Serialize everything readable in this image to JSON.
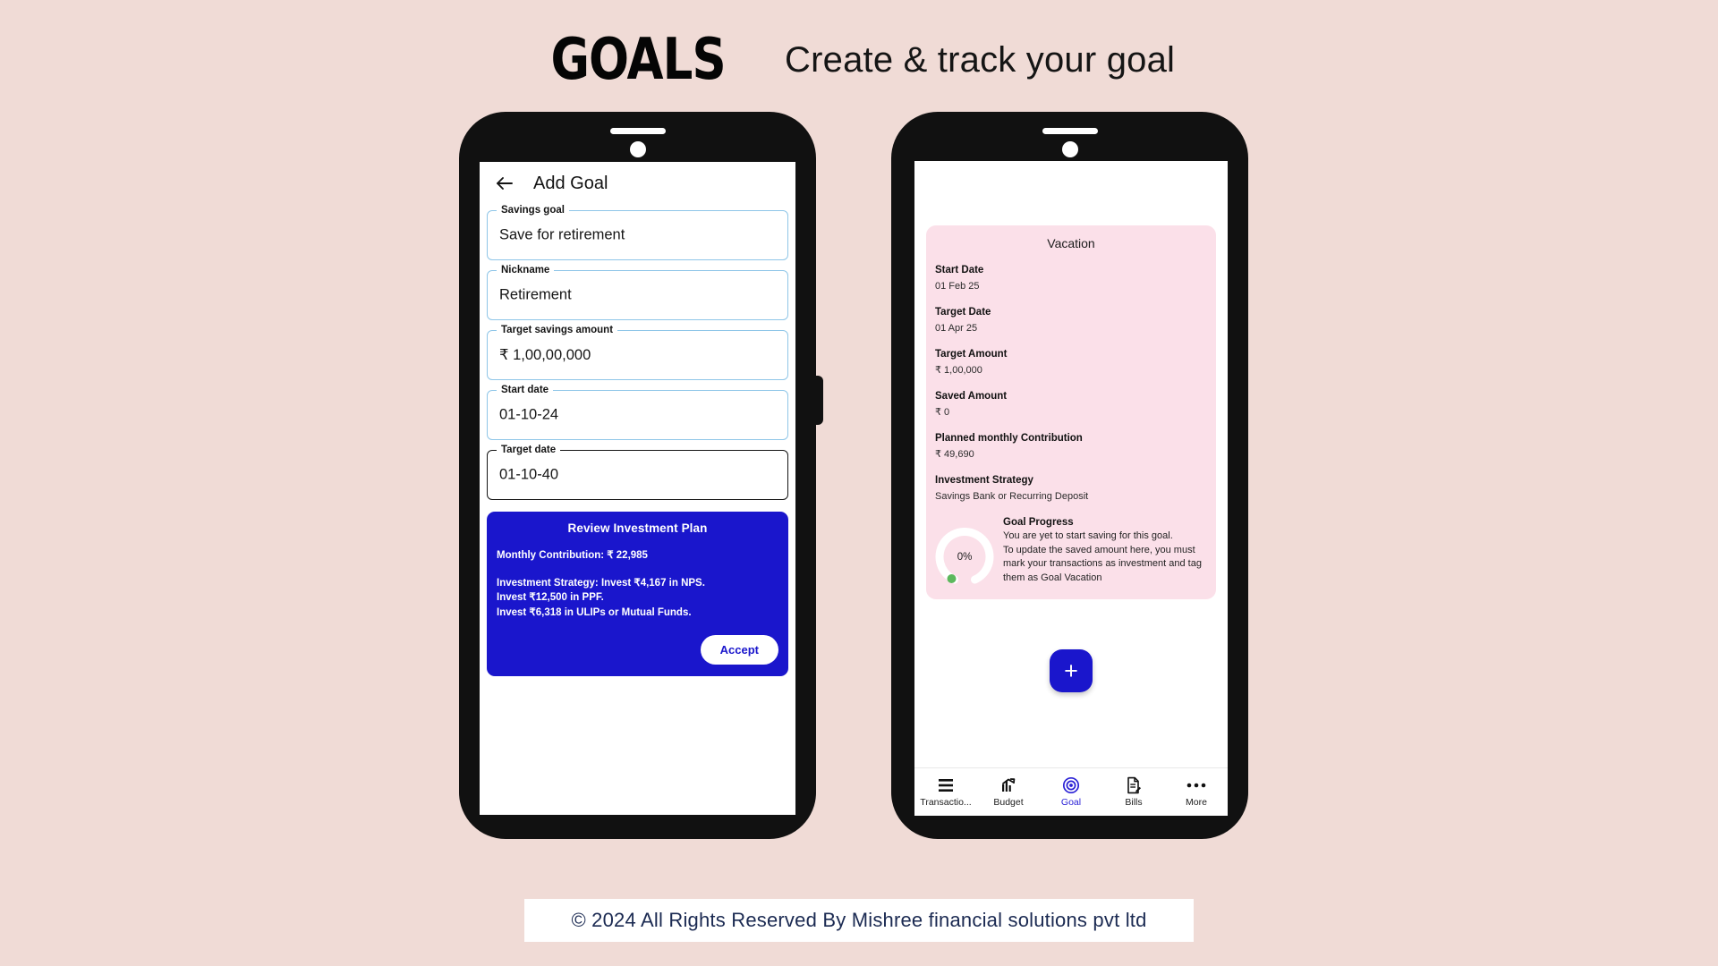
{
  "header": {
    "brand": "GOALS",
    "tagline": "Create & track your goal"
  },
  "left_phone": {
    "appbar": {
      "back_icon": "arrow-left-icon",
      "title": "Add Goal"
    },
    "fields": [
      {
        "label": "Savings goal",
        "value": "Save for retirement",
        "focused": false
      },
      {
        "label": "Nickname",
        "value": "Retirement",
        "focused": false
      },
      {
        "label": "Target savings amount",
        "value": "₹ 1,00,00,000",
        "focused": false
      },
      {
        "label": "Start date",
        "value": "01-10-24",
        "focused": false
      },
      {
        "label": "Target date",
        "value": "01-10-40",
        "focused": true
      }
    ],
    "review_panel": {
      "title": "Review Investment Plan",
      "monthly_contribution": "Monthly Contribution: ₹ 22,985",
      "strategy_lines": [
        "Investment Strategy: Invest ₹4,167 in NPS.",
        "Invest ₹12,500 in PPF.",
        "Invest ₹6,318 in ULIPs or Mutual Funds."
      ],
      "accept_label": "Accept",
      "background_color": "#1A16CC"
    }
  },
  "right_phone": {
    "goal_card": {
      "title": "Vacation",
      "background_color": "#FBE0E9",
      "details": [
        {
          "key": "Start Date",
          "value": "01 Feb 25"
        },
        {
          "key": "Target Date",
          "value": "01 Apr 25"
        },
        {
          "key": "Target Amount",
          "value": "₹ 1,00,000"
        },
        {
          "key": "Saved Amount",
          "value": "₹ 0"
        },
        {
          "key": "Planned monthly Contribution",
          "value": "₹ 49,690"
        },
        {
          "key": "Investment Strategy",
          "value": "Savings Bank  or Recurring Deposit"
        }
      ],
      "progress": {
        "percent_label": "0%",
        "percent_value": 0,
        "title": "Goal Progress",
        "body_lines": [
          "You are yet to start saving for this goal.",
          " To update the saved amount here, you must mark your transactions as investment and tag them as Goal Vacation"
        ],
        "track_color": "#FFFFFF",
        "marker_color": "#5CB85C"
      }
    },
    "fab": {
      "icon": "plus-icon",
      "color": "#1A16CC"
    },
    "bottom_nav": {
      "active": "Goal",
      "active_color": "#2A21D6",
      "items": [
        {
          "label": "Transactio...",
          "icon": "list-lines-icon"
        },
        {
          "label": "Budget",
          "icon": "bar-chart-arrow-icon"
        },
        {
          "label": "Goal",
          "icon": "target-icon"
        },
        {
          "label": "Bills",
          "icon": "document-pencil-icon"
        },
        {
          "label": "More",
          "icon": "ellipsis-icon"
        }
      ]
    }
  },
  "footer": {
    "text": "© 2024 All Rights Reserved By Mishree financial solutions pvt ltd"
  },
  "page": {
    "background_color": "#F0DBD6"
  }
}
